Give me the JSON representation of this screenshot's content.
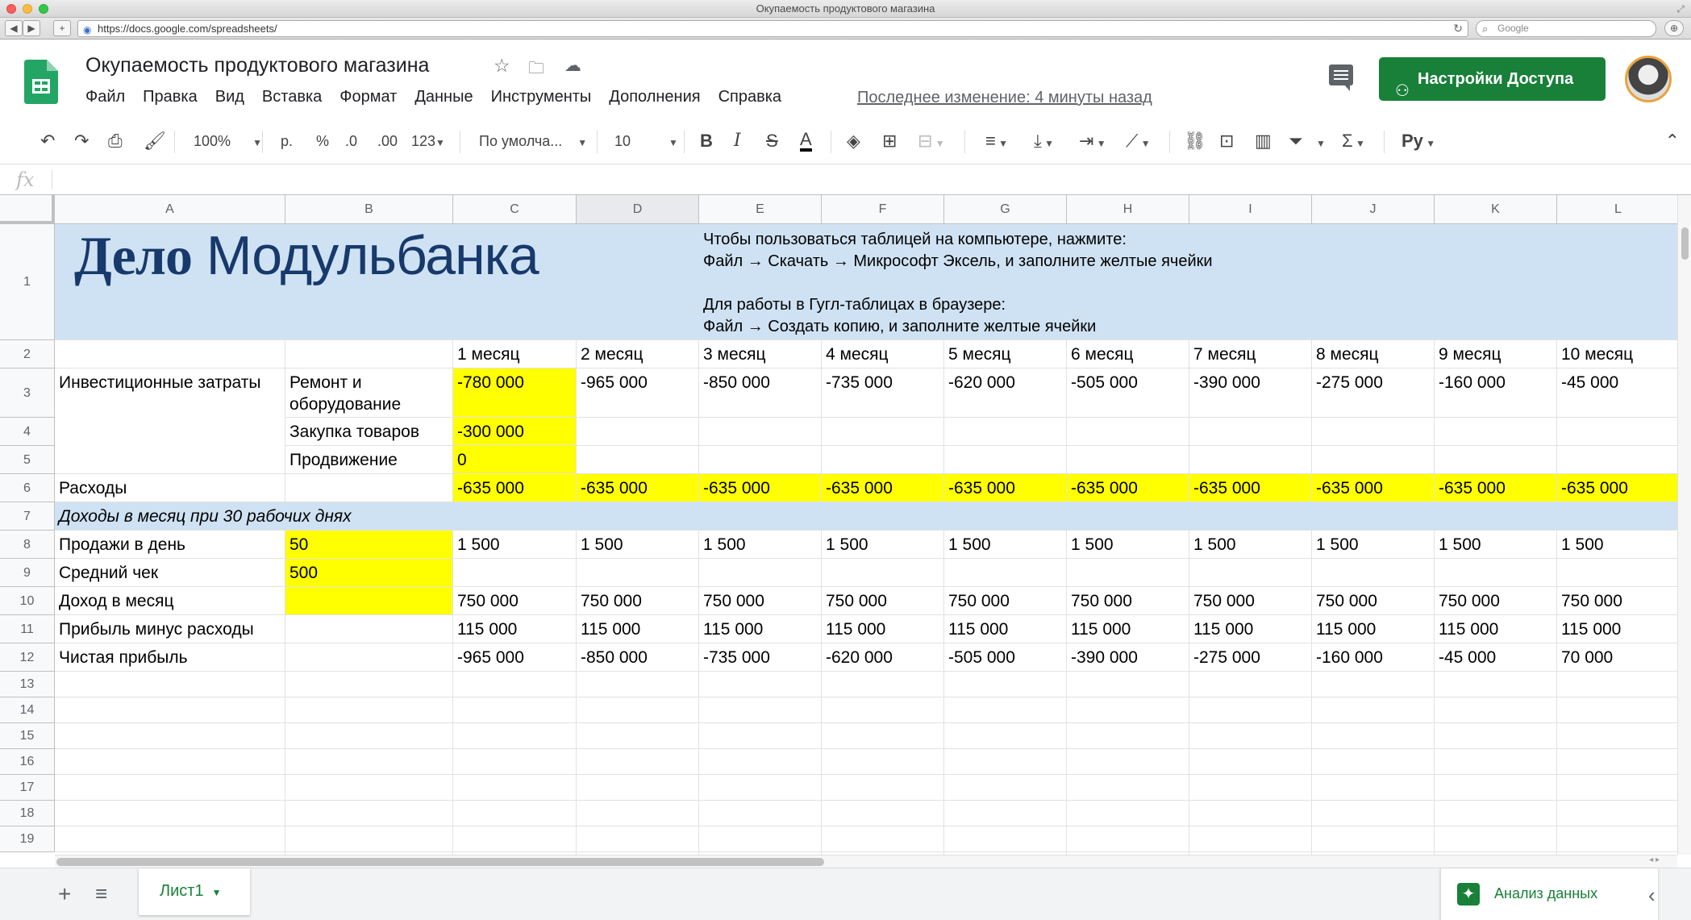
{
  "browser": {
    "window_title": "Окупаемость продуктового магазина",
    "url": "https://docs.google.com/spreadsheets/",
    "search_placeholder": "Google"
  },
  "doc": {
    "title": "Окупаемость продуктового магазина",
    "menu": [
      "Файл",
      "Правка",
      "Вид",
      "Вставка",
      "Формат",
      "Данные",
      "Инструменты",
      "Дополнения",
      "Справка"
    ],
    "last_edit": "Последнее изменение: 4 минуты назад",
    "share_label": "Настройки Доступа"
  },
  "toolbar": {
    "zoom": "100%",
    "currency": "р.",
    "percent": "%",
    "dec_decrease": ".0",
    "dec_increase": ".00",
    "more_formats": "123",
    "font": "По умолча...",
    "font_size": "10"
  },
  "formula_bar": {
    "fx": "fx",
    "value": ""
  },
  "columns": [
    "A",
    "B",
    "C",
    "D",
    "E",
    "F",
    "G",
    "H",
    "I",
    "J",
    "K",
    "L"
  ],
  "rows": [
    "1",
    "2",
    "3",
    "4",
    "5",
    "6",
    "7",
    "8",
    "9",
    "10",
    "11",
    "12",
    "13",
    "14",
    "15",
    "16",
    "17",
    "18",
    "19"
  ],
  "banner": {
    "logo_bold": "Дело",
    "logo_regular": "Модульбанка",
    "instructions": [
      "Чтобы пользоваться таблицей на компьютере, нажмите:",
      "Файл → Скачать → Микрософт Эксель, и заполните желтые ячейки",
      "",
      "Для работы в Гугл-таблицах в браузере:",
      "Файл → Создать копию, и заполните желтые ячейки"
    ]
  },
  "months": [
    "1 месяц",
    "2 месяц",
    "3 месяц",
    "4 месяц",
    "5 месяц",
    "6 месяц",
    "7 месяц",
    "8 месяц",
    "9 месяц",
    "10 месяц"
  ],
  "labels": {
    "investment": "Инвестиционные затраты",
    "repair": "Ремонт и оборудование",
    "purchase": "Закупка товаров",
    "promo": "Продвижение",
    "expenses": "Расходы",
    "income_section": "Доходы в месяц при 30 рабочих днях",
    "sales_per_day": "Продажи в день",
    "avg_check": "Средний чек",
    "income_month": "Доход в месяц",
    "profit_minus": "Прибыль минус расходы",
    "net_profit": "Чистая прибыль"
  },
  "values": {
    "repair_row": [
      "-780 000",
      "-965 000",
      "-850 000",
      "-735 000",
      "-620 000",
      "-505 000",
      "-390 000",
      "-275 000",
      "-160 000",
      "-45 000"
    ],
    "purchase": "-300 000",
    "promo": "0",
    "expenses_row": [
      "-635 000",
      "-635 000",
      "-635 000",
      "-635 000",
      "-635 000",
      "-635 000",
      "-635 000",
      "-635 000",
      "-635 000",
      "-635 000"
    ],
    "sales_per_day": "50",
    "sales_row": [
      "1 500",
      "1 500",
      "1 500",
      "1 500",
      "1 500",
      "1 500",
      "1 500",
      "1 500",
      "1 500",
      "1 500"
    ],
    "avg_check": "500",
    "income_row": [
      "750 000",
      "750 000",
      "750 000",
      "750 000",
      "750 000",
      "750 000",
      "750 000",
      "750 000",
      "750 000",
      "750 000"
    ],
    "profit_row": [
      "115 000",
      "115 000",
      "115 000",
      "115 000",
      "115 000",
      "115 000",
      "115 000",
      "115 000",
      "115 000",
      "115 000"
    ],
    "net_row": [
      "-965 000",
      "-850 000",
      "-735 000",
      "-620 000",
      "-505 000",
      "-390 000",
      "-275 000",
      "-160 000",
      "-45 000",
      "70 000"
    ]
  },
  "sheets": {
    "active": "Лист1",
    "explore_label": "Анализ данных"
  },
  "colors": {
    "highlight_yellow": "#ffff00",
    "banner_blue": "#cfe2f3",
    "brand_green": "#188038",
    "logo_navy": "#17396b"
  }
}
